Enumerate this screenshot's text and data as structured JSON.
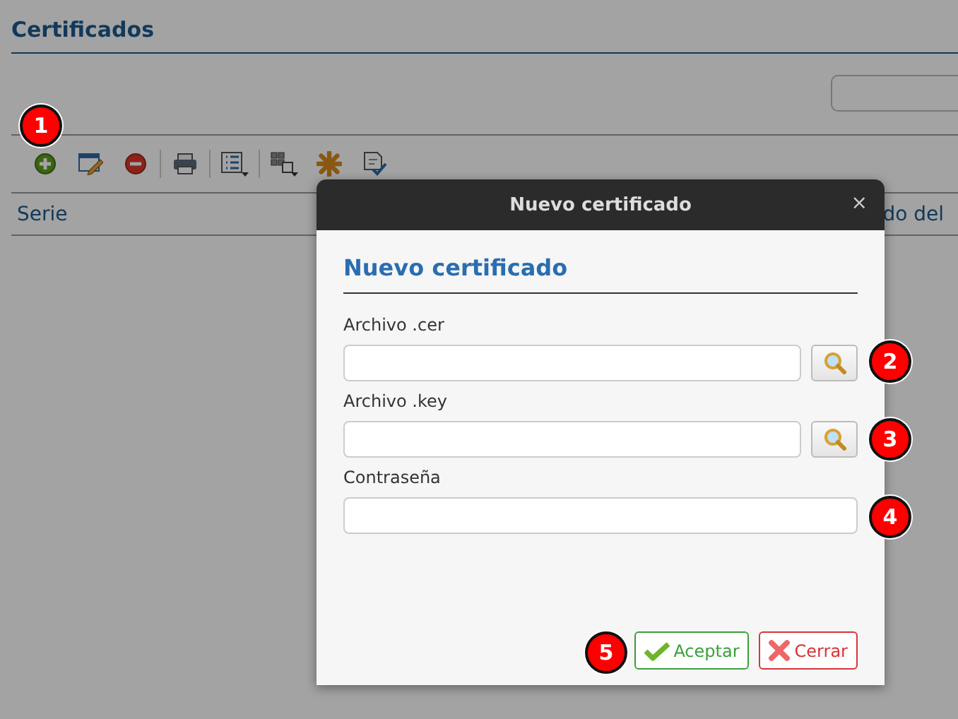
{
  "page": {
    "title": "Certificados"
  },
  "toolbar": [
    {
      "kind": "add"
    },
    {
      "kind": "edit"
    },
    {
      "kind": "delete"
    },
    {
      "kind": "separator"
    },
    {
      "kind": "print"
    },
    {
      "kind": "separator"
    },
    {
      "kind": "list"
    },
    {
      "kind": "separator"
    },
    {
      "kind": "grid"
    },
    {
      "kind": "asterisk"
    },
    {
      "kind": "check"
    }
  ],
  "columns": [
    {
      "label": "Serie"
    },
    {
      "label": "do del"
    }
  ],
  "dialog": {
    "title": "Nuevo certificado",
    "close": "×",
    "heading": "Nuevo certificado",
    "fields": [
      {
        "label": "Archivo .cer",
        "kind": "file"
      },
      {
        "label": "Archivo .key",
        "kind": "file"
      },
      {
        "label": "Contraseña",
        "kind": "password"
      }
    ],
    "buttons": [
      {
        "label": "Aceptar",
        "kind": "accept"
      },
      {
        "label": "Cerrar",
        "kind": "close"
      }
    ]
  },
  "callouts": [
    {
      "number": "1"
    },
    {
      "number": "2"
    },
    {
      "number": "3"
    },
    {
      "number": "4"
    },
    {
      "number": "5"
    }
  ]
}
